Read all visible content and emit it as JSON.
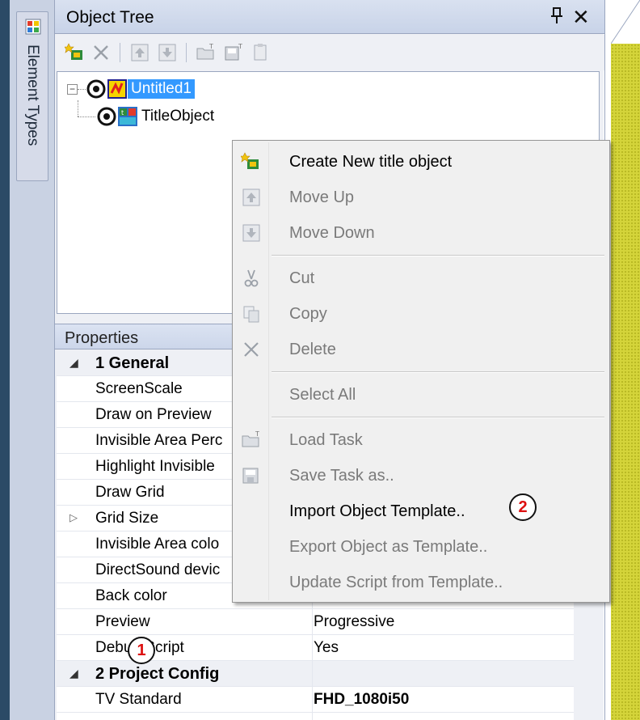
{
  "side_tab": {
    "label": "Element Types",
    "icon": "element-types-icon"
  },
  "object_tree": {
    "title": "Object Tree",
    "pin_glyph": "q",
    "close_glyph": "✕",
    "toolbar": [
      "create-new-icon",
      "delete-icon",
      "move-up-icon",
      "move-down-icon",
      "load-task-icon",
      "save-task-icon",
      "paste-template-icon"
    ],
    "nodes": [
      {
        "label": "Untitled1",
        "selected": true,
        "expander": "−"
      },
      {
        "label": "TitleObject",
        "selected": false
      }
    ]
  },
  "properties": {
    "header": "Properties",
    "rows": [
      {
        "type": "cat",
        "arrow": "◢",
        "name": "1 General",
        "value": ""
      },
      {
        "type": "prop",
        "name": "ScreenScale",
        "value": ""
      },
      {
        "type": "prop",
        "name": "Draw on Preview",
        "value": ""
      },
      {
        "type": "prop",
        "name": "Invisible Area Perc",
        "value": ""
      },
      {
        "type": "prop",
        "name": "Highlight Invisible",
        "value": ""
      },
      {
        "type": "prop",
        "name": "Draw Grid",
        "value": ""
      },
      {
        "type": "prop",
        "arrow": "▷",
        "name": "Grid Size",
        "value": ""
      },
      {
        "type": "prop",
        "name": "Invisible Area colo",
        "value": ""
      },
      {
        "type": "prop",
        "name": "DirectSound devic",
        "value": ""
      },
      {
        "type": "prop",
        "name": "Back color",
        "value": ""
      },
      {
        "type": "prop",
        "name": "Preview",
        "value": "Progressive"
      },
      {
        "type": "prop",
        "name": "Debug Script",
        "value": "Yes"
      },
      {
        "type": "cat",
        "arrow": "◢",
        "name": "2 Project Config",
        "value": ""
      },
      {
        "type": "prop",
        "name": "TV Standard",
        "value": "FHD_1080i50",
        "bold": true
      }
    ]
  },
  "context_menu": {
    "items": [
      {
        "label": "Create New title object",
        "icon": "create-new-icon",
        "enabled": true
      },
      {
        "label": "Move Up",
        "icon": "move-up-icon",
        "enabled": false
      },
      {
        "label": "Move Down",
        "icon": "move-down-icon",
        "enabled": false
      },
      {
        "sep": true
      },
      {
        "label": "Cut",
        "icon": "cut-icon",
        "enabled": false
      },
      {
        "label": "Copy",
        "icon": "copy-icon",
        "enabled": false
      },
      {
        "label": "Delete",
        "icon": "delete-icon",
        "enabled": false
      },
      {
        "sep": true
      },
      {
        "label": "Select All",
        "icon": "",
        "enabled": false
      },
      {
        "sep": true
      },
      {
        "label": "Load Task",
        "icon": "load-task-icon",
        "enabled": false
      },
      {
        "label": "Save Task as..",
        "icon": "save-task-icon",
        "enabled": false
      },
      {
        "label": "Import Object Template..",
        "icon": "",
        "enabled": true
      },
      {
        "label": "Export Object as Template..",
        "icon": "",
        "enabled": false
      },
      {
        "label": "Update Script from Template..",
        "icon": "",
        "enabled": false
      }
    ]
  },
  "annotations": [
    {
      "label": "1"
    },
    {
      "label": "2"
    }
  ],
  "colors": {
    "selection": "#3399ff",
    "back_color_swatch": "#2f4f4f",
    "yellow_area": "#d4d43a",
    "badge_text": "#dd1111"
  }
}
